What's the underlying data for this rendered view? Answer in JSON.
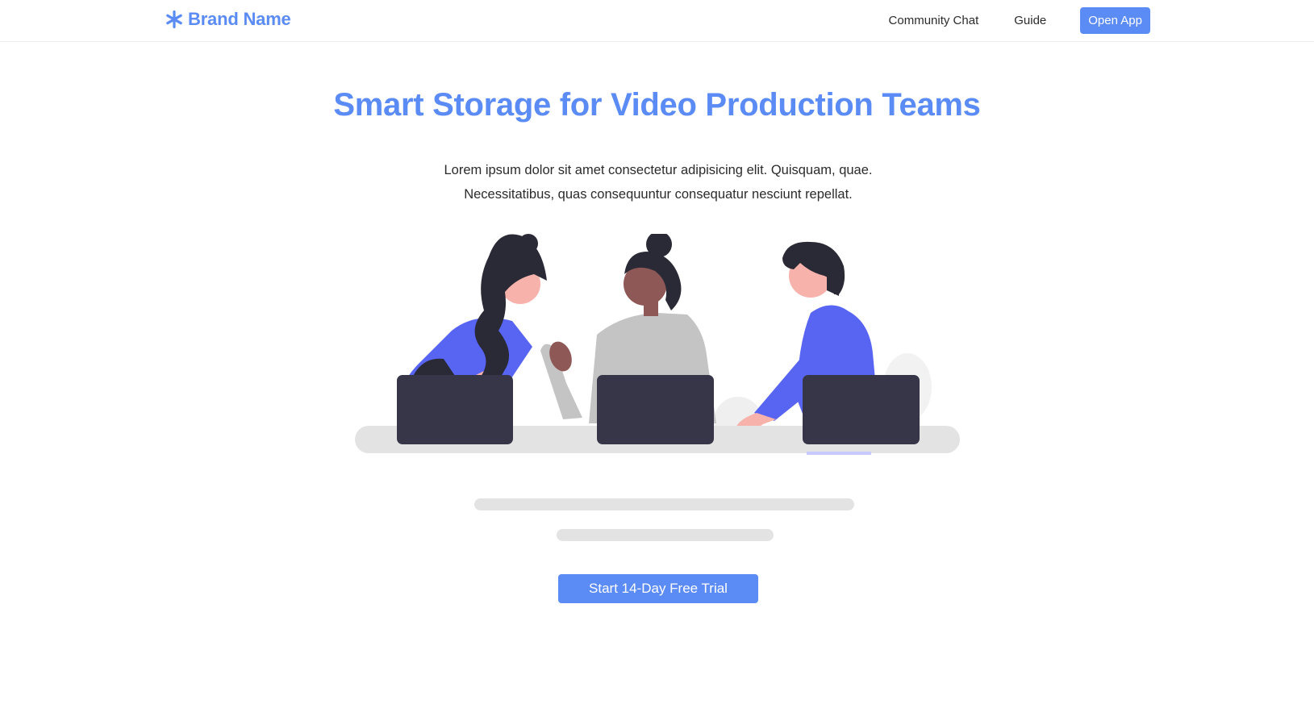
{
  "navbar": {
    "brand_icon": "asterisk-icon",
    "brand_name": "Brand Name",
    "links": [
      "Community Chat",
      "Guide"
    ],
    "cta_label": "Open App"
  },
  "hero": {
    "title": "Smart Storage for Video Production Teams",
    "description_line1": "Lorem ipsum dolor sit amet consectetur adipisicing elit. Quisquam, quae.",
    "description_line2": "Necessitatibus, quas consequuntur consequatur nesciunt repellat.",
    "cta_label": "Start 14-Day Free Trial"
  },
  "colors": {
    "accent": "#5b8bf4",
    "illustration_purple": "#5865f2",
    "laptop": "#363648",
    "hair": "#2a2a37",
    "skin_light": "#f7b2ab",
    "skin_dark": "#8e5856",
    "shirt_gray": "#c4c4c4",
    "table": "#e3e3e3"
  }
}
